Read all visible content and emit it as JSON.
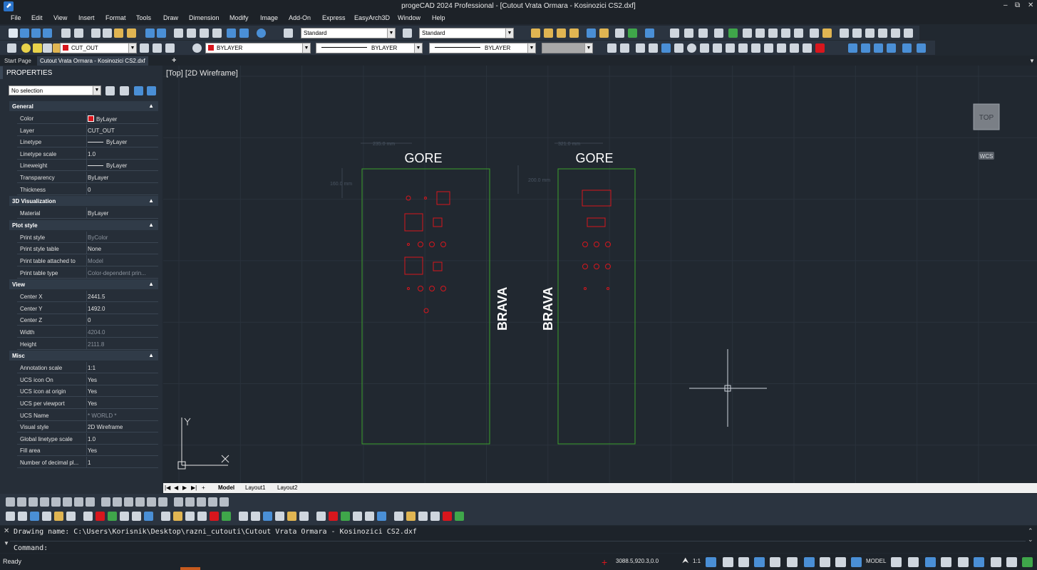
{
  "title_bar": {
    "title": "progeCAD 2024 Professional - [Cutout Vrata Ormara - Kosinozici CS2.dxf]"
  },
  "menu": [
    "File",
    "Edit",
    "View",
    "Insert",
    "Format",
    "Tools",
    "Draw",
    "Dimension",
    "Modify",
    "Image",
    "Add-On",
    "Express",
    "EasyArch3D",
    "Window",
    "Help"
  ],
  "toolbar": {
    "text_style": "Standard",
    "dim_style": "Standard",
    "layer": "CUT_OUT",
    "color": "BYLAYER",
    "linetype": "BYLAYER",
    "lineweight": "BYLAYER"
  },
  "doc_tabs": {
    "start": "Start Page",
    "active": "Cutout Vrata Ormara - Kosinozici CS2.dxf",
    "add": "+"
  },
  "properties": {
    "header": "PROPERTIES",
    "selection": "No selection",
    "sections": [
      {
        "name": "General",
        "rows": [
          {
            "k": "Color",
            "v": "ByLayer"
          },
          {
            "k": "Layer",
            "v": "CUT_OUT"
          },
          {
            "k": "Linetype",
            "v": "ByLayer"
          },
          {
            "k": "Linetype scale",
            "v": "1.0"
          },
          {
            "k": "Lineweight",
            "v": "ByLayer"
          },
          {
            "k": "Transparency",
            "v": "ByLayer"
          },
          {
            "k": "Thickness",
            "v": "0"
          }
        ]
      },
      {
        "name": "3D Visualization",
        "rows": [
          {
            "k": "Material",
            "v": "ByLayer"
          }
        ]
      },
      {
        "name": "Plot style",
        "rows": [
          {
            "k": "Print style",
            "v": "ByColor"
          },
          {
            "k": "Print style table",
            "v": "None"
          },
          {
            "k": "Print table attached to",
            "v": "Model"
          },
          {
            "k": "Print table type",
            "v": "Color-dependent prin..."
          }
        ]
      },
      {
        "name": "View",
        "rows": [
          {
            "k": "Center X",
            "v": "2441.5"
          },
          {
            "k": "Center Y",
            "v": "1492.0"
          },
          {
            "k": "Center Z",
            "v": "0"
          },
          {
            "k": "Width",
            "v": "4204.0"
          },
          {
            "k": "Height",
            "v": "2111.8"
          }
        ]
      },
      {
        "name": "Misc",
        "rows": [
          {
            "k": "Annotation scale",
            "v": "1:1"
          },
          {
            "k": "UCS icon On",
            "v": "Yes"
          },
          {
            "k": "UCS icon at origin",
            "v": "Yes"
          },
          {
            "k": "UCS per viewport",
            "v": "Yes"
          },
          {
            "k": "UCS Name",
            "v": "* WORLD *"
          },
          {
            "k": "Visual style",
            "v": "2D Wireframe"
          },
          {
            "k": "Global linetype scale",
            "v": "1.0"
          },
          {
            "k": "Fill area",
            "v": "Yes"
          },
          {
            "k": "Number of decimal pl...",
            "v": "1"
          }
        ]
      }
    ]
  },
  "viewport": {
    "label": "[Top] [2D Wireframe]",
    "viewcube": "TOP",
    "wcs": "WCS",
    "panel_top_text": "GORE",
    "panel_side_text": "BRAVA",
    "dim_width_left": "235.0 mm",
    "dim_width_right": "321.0 mm",
    "dim_height_left": "160.0 mm",
    "dim_height_right": "200.0 mm",
    "ucs_x": "X",
    "ucs_y": "Y"
  },
  "layout_tabs": [
    "Model",
    "Layout1",
    "Layout2"
  ],
  "command": {
    "history": "Drawing name: C:\\Users\\Korisnik\\Desktop\\razni_cutouti\\Cutout Vrata Ormara - Kosinozici CS2.dxf",
    "prompt": "Command:"
  },
  "status": {
    "ready": "Ready",
    "coords": "3088.5,920.3,0.0",
    "scale": "1:1",
    "space": "MODEL"
  },
  "colors": {
    "canvas": "#212830",
    "outline": "#3aa12b",
    "cutout": "#d8161d"
  }
}
